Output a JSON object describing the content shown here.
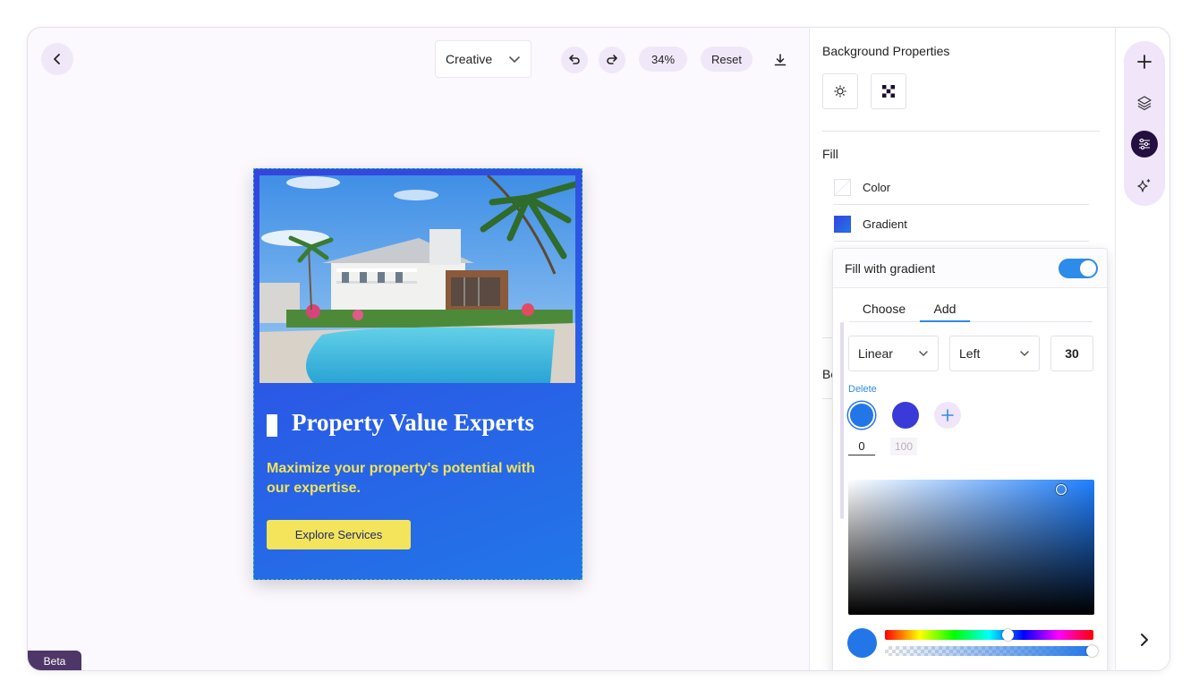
{
  "toolbar": {
    "mode": "Creative",
    "zoom": "34%",
    "reset_label": "Reset"
  },
  "creative": {
    "headline": "Property Value Experts",
    "subheadline": "Maximize your property's potential with our expertise.",
    "cta_label": "Explore Services",
    "colors": {
      "gradient_start": "#3544dd",
      "gradient_end": "#2276e8",
      "text_accent": "#f2e35a",
      "button_bg": "#f3e45b"
    }
  },
  "badge": {
    "beta": "Beta"
  },
  "properties": {
    "title": "Background Properties",
    "fill_title": "Fill",
    "fill_options": [
      {
        "label": "Color",
        "swatch": "#ffffff"
      },
      {
        "label": "Gradient",
        "swatch": "#2b57e0"
      }
    ],
    "truncated_label": "Bo"
  },
  "gradient_popover": {
    "title": "Fill with gradient",
    "enabled": true,
    "tabs": [
      "Choose",
      "Add"
    ],
    "active_tab": "Add",
    "type": "Linear",
    "direction": "Left",
    "angle": "30",
    "delete_label": "Delete",
    "stops": [
      {
        "color": "#2276e8",
        "position": "0"
      },
      {
        "color": "#3a3ad8",
        "position": "100"
      }
    ],
    "picker": {
      "selected_color": "#2276e8",
      "hue_fraction": 0.59,
      "alpha_fraction": 1.0
    }
  },
  "icons": {
    "back": "chevron-left-icon",
    "undo": "undo-icon",
    "redo": "redo-icon",
    "download": "download-icon",
    "rail": [
      "plus-icon",
      "layers-icon",
      "sliders-icon",
      "sparkle-icon"
    ],
    "next": "chevron-right-icon"
  }
}
